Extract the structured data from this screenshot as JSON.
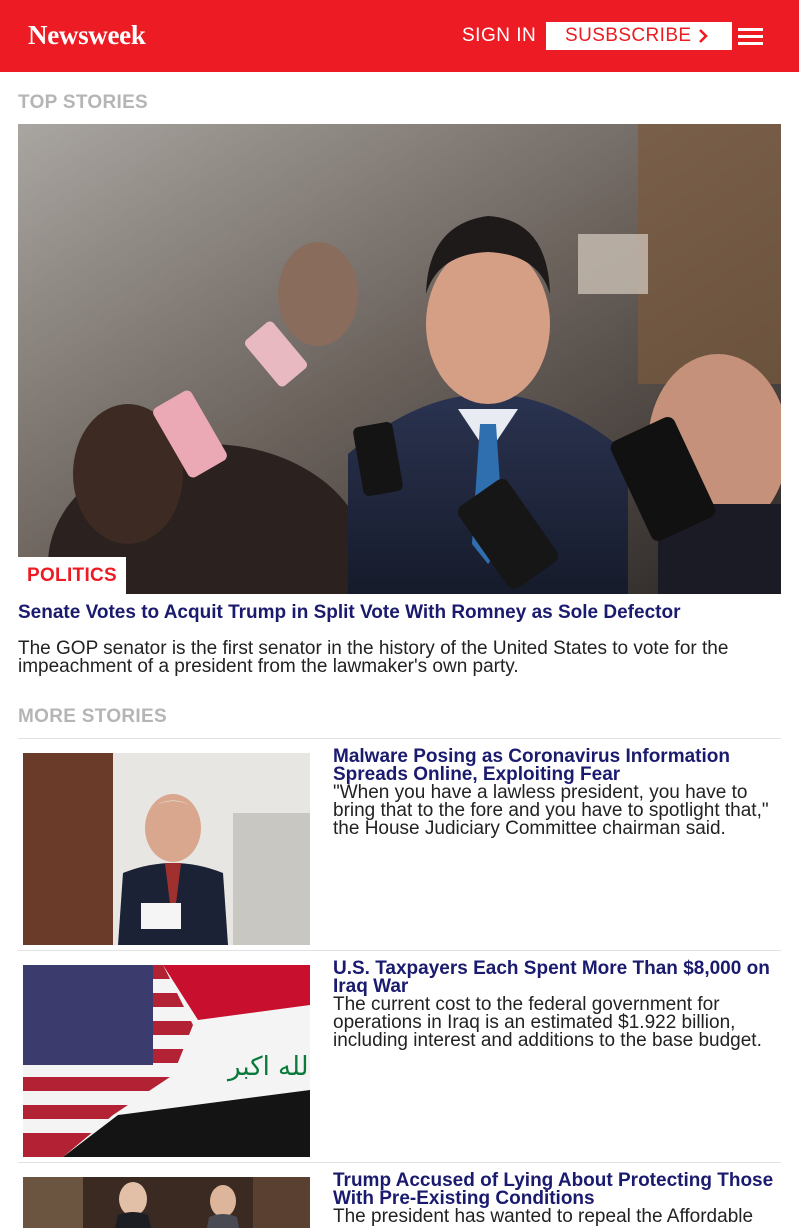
{
  "header": {
    "logo": "Newsweek",
    "signin_label": "SIGN IN",
    "subscribe_label": "SUSBSCRIBE",
    "brand_color": "#ed1c24"
  },
  "top_stories": {
    "label": "TOP STORIES",
    "hero": {
      "category": "POLITICS",
      "title": "Senate Votes to Acquit Trump in Split Vote With Romney as Sole Defector",
      "dek": "The GOP senator is the first senator in the history of the United States to vote for the impeachment of a president from the lawmaker's own party."
    }
  },
  "more_stories": {
    "label": "MORE STORIES",
    "items": [
      {
        "title": "Malware Posing as Coronavirus Information Spreads Online, Exploiting Fear",
        "dek": "\"When you have a lawless president, you have to bring that to the fore and you have to spotlight that,\" the House Judiciary Committee chairman said."
      },
      {
        "title": "U.S. Taxpayers Each Spent More Than $8,000 on Iraq War",
        "dek": "The current cost to the federal government for operations in Iraq is an estimated $1.922 billion, including interest and additions to the base budget."
      },
      {
        "title": "Trump Accused of Lying About Protecting Those With Pre-Existing Conditions",
        "dek": "The president has wanted to repeal the Affordable"
      }
    ]
  }
}
